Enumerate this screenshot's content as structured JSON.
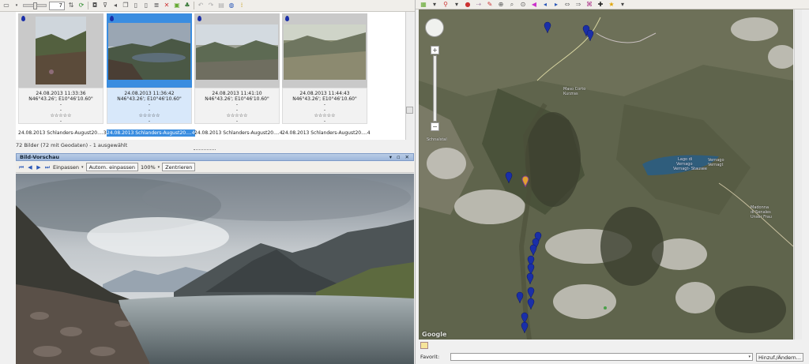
{
  "toolbar": {
    "zoom_value": "7"
  },
  "thumbnails": [
    {
      "datetime": "24.08.2013 11:33:36",
      "coords": "N46°43.26'; E10°46'10.60\"",
      "dash1": "-",
      "dash2": "-",
      "stars": "☆☆☆☆☆",
      "dash3": "-",
      "filename": "24.08.2013 Schlanders-August20....39.JPG",
      "selected": false
    },
    {
      "datetime": "24.08.2013 11:36:42",
      "coords": "N46°43.26'; E10°46'10.60\"",
      "dash1": "-",
      "dash2": "-",
      "stars": "☆☆☆☆☆",
      "dash3": "-",
      "filename": "24.08.2013 Schlanders-August20....40.JPG",
      "selected": true
    },
    {
      "datetime": "24.08.2013 11:41:10",
      "coords": "N46°43.26'; E10°46'10.60\"",
      "dash1": "-",
      "dash2": "-",
      "stars": "☆☆☆☆☆",
      "dash3": "-",
      "filename": "24.08.2013 Schlanders-August20....41.JPG",
      "selected": false
    },
    {
      "datetime": "24.08.2013 11:44:43",
      "coords": "N46°43.26'; E10°46'10.60\"",
      "dash1": "-",
      "dash2": "-",
      "stars": "☆☆☆☆☆",
      "dash3": "-",
      "filename": "24.08.2013 Schlanders-August20....42.JPG",
      "selected": false
    }
  ],
  "status": {
    "text": "72 Bilder (72 mit Geodaten) - 1 ausgewählt"
  },
  "preview": {
    "title": "Bild-Vorschau",
    "window_controls": "▾ ▫ ✕",
    "fit_label": "Einpassen",
    "auto_fit_label": "Autom. einpassen",
    "zoom_label": "100%",
    "center_label": "Zentrieren"
  },
  "map": {
    "labels": {
      "l1": "Lago di",
      "l2": "Vernago",
      "l3": "Vernagt- Stausee",
      "l4": "Vernago",
      "l5": "Vernagt",
      "m1": "Madonna",
      "m2": "di Senales",
      "m3": "Unser Frau",
      "v1": "Maso Corto",
      "v2": "Kurzras",
      "s1": "Schnalstal"
    },
    "attribution": "Google"
  },
  "footer": {
    "favorit_label": "Favorit:",
    "favorit_value": "",
    "add_button": "Hinzuf./Ändern..."
  },
  "colors": {
    "selection": "#3a8de0",
    "pin": "#1a2fa8",
    "title_bar": "#9eb7db"
  }
}
